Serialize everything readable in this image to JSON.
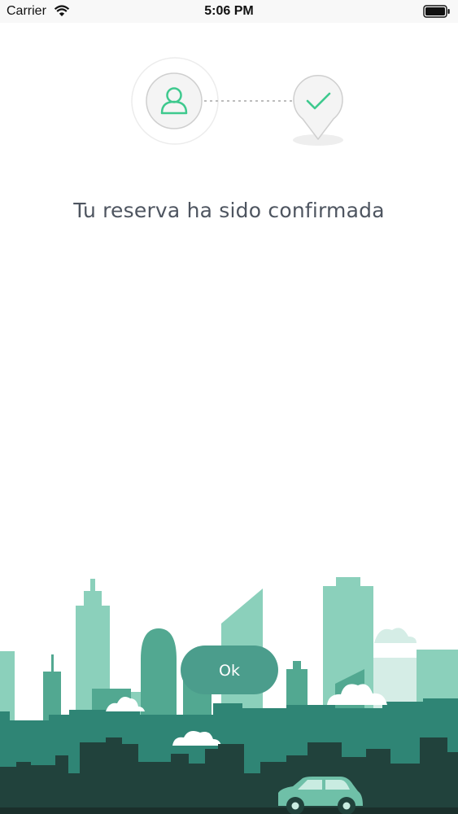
{
  "status_bar": {
    "carrier": "Carrier",
    "time": "5:06 PM"
  },
  "confirmation": {
    "message": "Tu reserva ha sido confirmada"
  },
  "actions": {
    "ok_label": "Ok"
  },
  "colors": {
    "accent": "#3ec98e",
    "button": "#4b9d8c",
    "text": "#4e5560"
  },
  "icons": [
    "wifi-icon",
    "battery-icon",
    "user-icon",
    "check-icon",
    "car-icon"
  ]
}
